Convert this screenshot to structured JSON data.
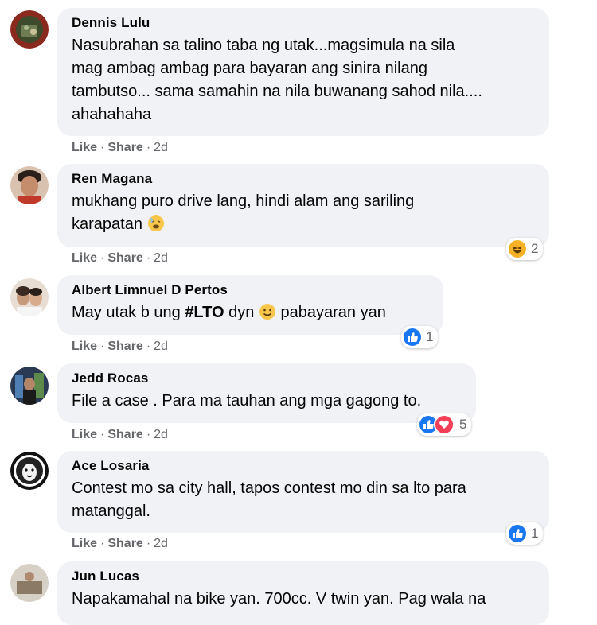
{
  "actions": {
    "like": "Like",
    "share": "Share",
    "sep": "·"
  },
  "comments": [
    {
      "author": "Dennis Lulu",
      "text": "Nasubrahan sa talino taba ng utak...magsimula na sila\nmag ambag ambag para bayaran ang sinira nilang\ntambutso... sama samahin na nila buwanang sahod nila....\nahahahaha",
      "time": "2d",
      "avatar_icon": "profile-photo"
    },
    {
      "author": "Ren Magana",
      "text_before": "mukhang puro drive lang, hindi alam ang sariling\nkarapatan ",
      "emoji": "weary-face-emoji",
      "time": "2d",
      "reaction_types": [
        "haha"
      ],
      "reaction_count": "2",
      "avatar_icon": "profile-photo"
    },
    {
      "author": "Albert Limnuel D Pertos",
      "text_before": "May utak b ung ",
      "hashtag": "#LTO",
      "text_mid": " dyn ",
      "emoji": "slightly-smiling-face-emoji",
      "text_after": " pabayaran yan",
      "time": "2d",
      "reaction_types": [
        "like"
      ],
      "reaction_count": "1",
      "avatar_icon": "profile-photo"
    },
    {
      "author": "Jedd Rocas",
      "text": "File a case . Para ma tauhan ang mga gagong to.",
      "time": "2d",
      "reaction_types": [
        "like",
        "love"
      ],
      "reaction_count": "5",
      "avatar_icon": "profile-photo"
    },
    {
      "author": "Ace Losaria",
      "text": "Contest mo sa city hall, tapos contest mo din sa lto para\nmatanggal.",
      "time": "2d",
      "reaction_types": [
        "like"
      ],
      "reaction_count": "1",
      "avatar_icon": "profile-photo"
    },
    {
      "author": "Jun Lucas",
      "text": "Napakamahal na bike yan. 700cc. V twin yan. Pag wala na",
      "avatar_icon": "profile-photo"
    }
  ],
  "colors": {
    "bubble": "#f0f2f5",
    "secondary_text": "#65676b",
    "like_blue": "#1877f2",
    "love_red": "#f33e58",
    "haha_yellow": "#f7b125"
  }
}
